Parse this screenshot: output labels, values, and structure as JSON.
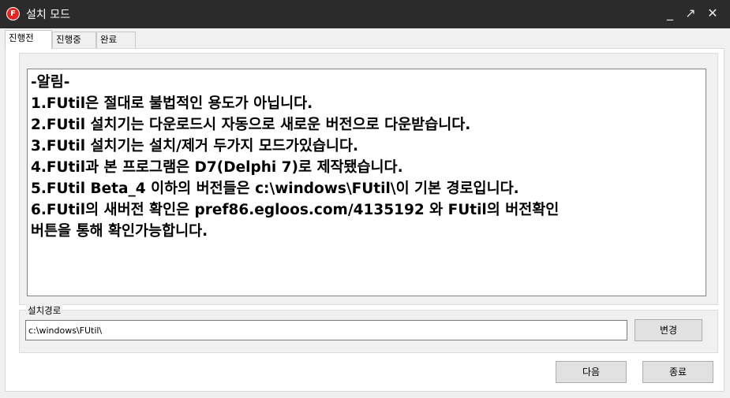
{
  "window": {
    "title": "설치 모드",
    "icon_letter": "F",
    "minimize_glyph": "_",
    "maximize_glyph": "↗",
    "close_glyph": "✕"
  },
  "tabs": [
    {
      "label": "진행전",
      "active": true
    },
    {
      "label": "진행중",
      "active": false
    },
    {
      "label": "완료",
      "active": false
    }
  ],
  "notice": {
    "lines": [
      "-알림-",
      "1.FUtil은 절대로 불법적인 용도가 아닙니다.",
      "2.FUtil 설치기는 다운로드시 자동으로 새로운 버전으로 다운받습니다.",
      "3.FUtil 설치기는 설치/제거 두가지 모드가있습니다.",
      "4.FUtil과 본 프로그램은 D7(Delphi 7)로 제작됐습니다.",
      "5.FUtil Beta_4 이하의 버전들은 c:\\windows\\FUtil\\이 기본 경로입니다.",
      "6.FUtil의 새버전 확인은 pref86.egloos.com/4135192 와 FUtil의 버전확인",
      "버튼을 통해 확인가능합니다."
    ]
  },
  "install_path": {
    "group_label": "설치경로",
    "value": "c:\\windows\\FUtil\\",
    "change_button": "변경"
  },
  "footer": {
    "next_button": "다음",
    "exit_button": "종료"
  },
  "colors": {
    "titlebar": "#2b2b2b",
    "app_icon": "#e8231f"
  }
}
